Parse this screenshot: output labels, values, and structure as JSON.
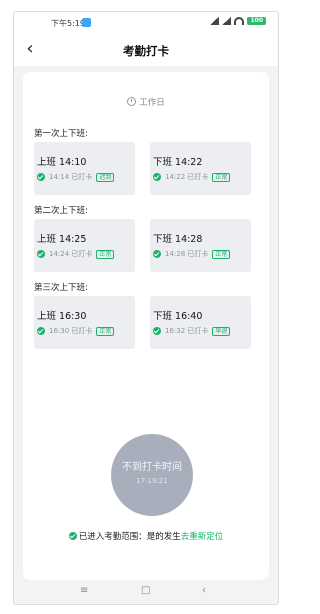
{
  "status": {
    "time": "下午5:19",
    "battery": "100"
  },
  "header": {
    "title": "考勤打卡"
  },
  "workday_label": "工作日",
  "rounds": [
    {
      "title": "第一次上下班:",
      "on": {
        "time": "上班 14:10",
        "record": "14:14 已打卡",
        "badge": "迟到"
      },
      "off": {
        "time": "下班 14:22",
        "record": "14:22 已打卡",
        "badge": "正常"
      }
    },
    {
      "title": "第二次上下班:",
      "on": {
        "time": "上班 14:25",
        "record": "14:24 已打卡",
        "badge": "正常"
      },
      "off": {
        "time": "下班 14:28",
        "record": "14:28 已打卡",
        "badge": "正常"
      }
    },
    {
      "title": "第三次上下班:",
      "on": {
        "time": "上班 16:30",
        "record": "16:30 已打卡",
        "badge": "正常"
      },
      "off": {
        "time": "下班 16:40",
        "record": "16:32 已打卡",
        "badge": "早退"
      }
    }
  ],
  "punch_button": {
    "label": "不到打卡时间",
    "time": "17:19:21"
  },
  "range": {
    "text": "已进入考勤范围：是的发生",
    "link": "去重新定位"
  },
  "colors": {
    "accent": "#19b36b",
    "button": "#a9aebc"
  },
  "icons": [
    "back-arrow-icon",
    "clock-icon",
    "check-circle-icon",
    "menu-icon",
    "home-icon",
    "back-nav-icon"
  ]
}
